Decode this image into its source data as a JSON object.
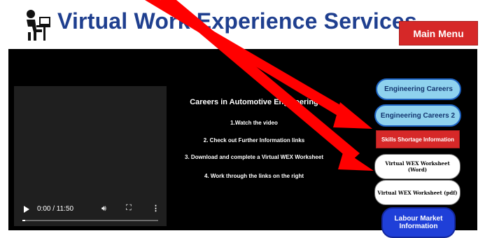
{
  "header": {
    "title": "Virtual Work Experience Services",
    "main_menu_label": "Main Menu"
  },
  "info": {
    "title": "Careers in Automotive Engineering",
    "steps": [
      "1.Watch the video",
      "2. Check out Further Information links",
      "3. Download and complete a Virtual WEX Worksheet",
      "4. Work through the links on the right"
    ]
  },
  "video": {
    "time": "0:00 / 11:50",
    "progress_fraction": 0.0
  },
  "links": {
    "careers_1": "Engineering Careers",
    "careers_2": "Engineering Careers 2",
    "skills_shortage": "Skills Shortage Information",
    "worksheet_word": "Virtual WEX Worksheet (Word)",
    "worksheet_pdf": "Virtual WEX Worksheet (pdf)",
    "labour_market": "Labour Market Information"
  },
  "colors": {
    "title_blue": "#1f3f8f",
    "menu_red": "#d62828",
    "pill_light_blue": "#8fd2ee",
    "pill_dark_blue": "#1f3fd8",
    "annotation_red": "#ff0000"
  },
  "icons": [
    "person-at-computer-icon",
    "play-icon",
    "volume-icon",
    "fullscreen-icon",
    "more-options-icon",
    "annotation-arrow-icon"
  ]
}
